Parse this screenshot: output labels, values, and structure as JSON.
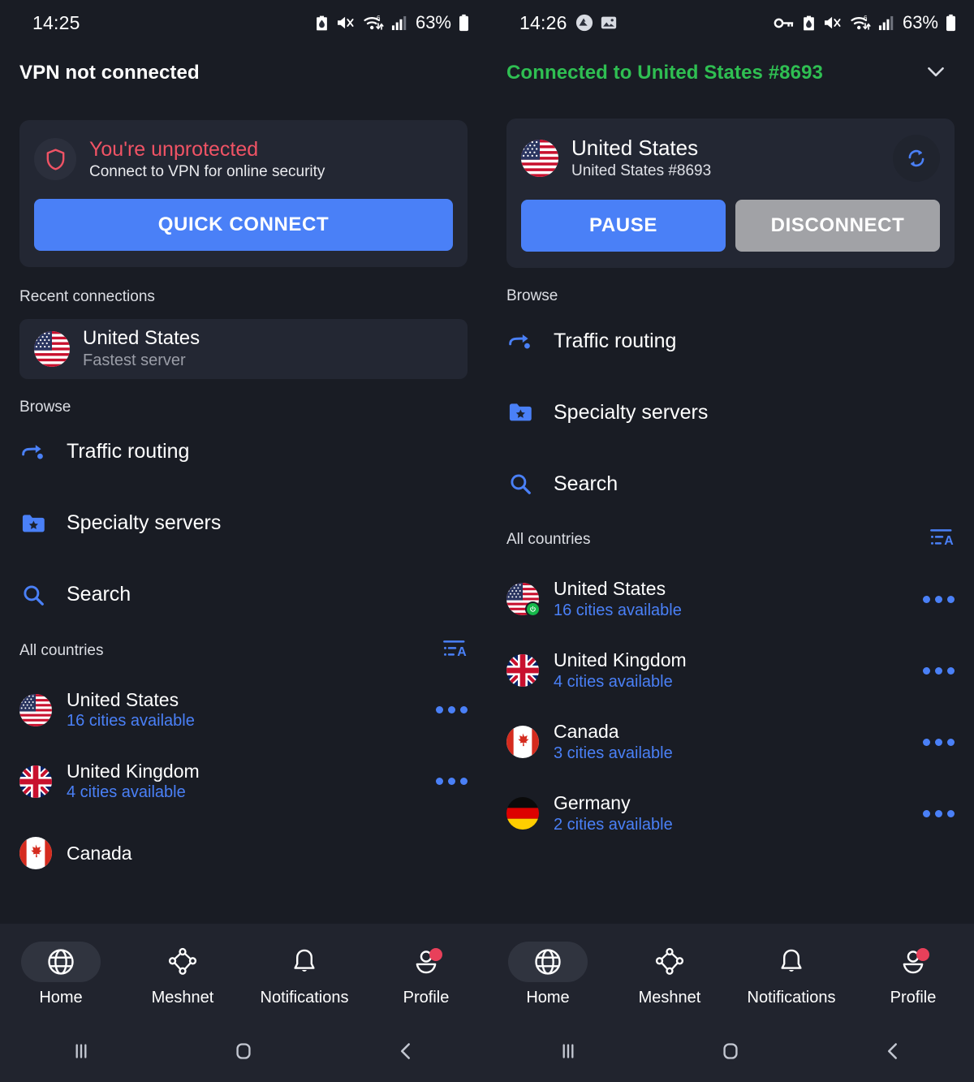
{
  "app": {
    "accent_blue": "#4a80f7",
    "danger_red": "#f05365",
    "connected_green": "#2fbf52"
  },
  "left": {
    "status_bar": {
      "time": "14:25",
      "battery_percent": "63%",
      "icons": [
        "battery-saver-icon",
        "mute-icon",
        "wifi-6-icon",
        "signal-bars-icon",
        "battery-icon"
      ]
    },
    "header": {
      "title": "VPN not connected"
    },
    "card": {
      "icon": "shield-icon",
      "title": "You're unprotected",
      "subtitle": "Connect to VPN for online security",
      "primary_button": "QUICK CONNECT"
    },
    "recent": {
      "label": "Recent connections",
      "item": {
        "flag": "us-flag-icon",
        "name": "United States",
        "subtitle": "Fastest server"
      }
    },
    "browse": {
      "label": "Browse",
      "items": [
        {
          "icon": "traffic-routing-icon",
          "label": "Traffic routing"
        },
        {
          "icon": "specialty-servers-icon",
          "label": "Specialty servers"
        },
        {
          "icon": "search-icon",
          "label": "Search"
        }
      ]
    },
    "all_countries": {
      "label": "All countries",
      "sort_icon": "sort-alpha-icon",
      "rows": [
        {
          "flag": "us-flag-icon",
          "name": "United States",
          "cities": "16 cities available",
          "connected": false
        },
        {
          "flag": "uk-flag-icon",
          "name": "United Kingdom",
          "cities": "4 cities available",
          "connected": false
        },
        {
          "flag": "ca-flag-icon",
          "name": "Canada",
          "cities": "",
          "connected": false
        }
      ]
    },
    "tabs": [
      {
        "icon": "globe-icon",
        "label": "Home",
        "active": true,
        "badge": false
      },
      {
        "icon": "meshnet-icon",
        "label": "Meshnet",
        "active": false,
        "badge": false
      },
      {
        "icon": "bell-icon",
        "label": "Notifications",
        "active": false,
        "badge": false
      },
      {
        "icon": "profile-icon",
        "label": "Profile",
        "active": false,
        "badge": true
      }
    ],
    "android_nav": [
      "recents-icon",
      "home-icon",
      "back-icon"
    ]
  },
  "right": {
    "status_bar": {
      "time": "14:26",
      "battery_percent": "63%",
      "left_icons": [
        "nord-vpn-icon",
        "screenshot-icon"
      ],
      "icons": [
        "vpn-key-icon",
        "battery-saver-icon",
        "mute-icon",
        "wifi-6-icon",
        "signal-bars-icon",
        "battery-icon"
      ]
    },
    "header": {
      "title": "Connected to United States #8693",
      "chevron": "chevron-down-icon"
    },
    "card": {
      "flag": "us-flag-icon",
      "title": "United States",
      "subtitle": "United States #8693",
      "refresh_icon": "refresh-icon",
      "primary_button": "PAUSE",
      "secondary_button": "DISCONNECT"
    },
    "browse": {
      "label": "Browse",
      "items": [
        {
          "icon": "traffic-routing-icon",
          "label": "Traffic routing"
        },
        {
          "icon": "specialty-servers-icon",
          "label": "Specialty servers"
        },
        {
          "icon": "search-icon",
          "label": "Search"
        }
      ]
    },
    "all_countries": {
      "label": "All countries",
      "sort_icon": "sort-alpha-icon",
      "rows": [
        {
          "flag": "us-flag-icon",
          "name": "United States",
          "cities": "16 cities available",
          "connected": true
        },
        {
          "flag": "uk-flag-icon",
          "name": "United Kingdom",
          "cities": "4 cities available",
          "connected": false
        },
        {
          "flag": "ca-flag-icon",
          "name": "Canada",
          "cities": "3 cities available",
          "connected": false
        },
        {
          "flag": "de-flag-icon",
          "name": "Germany",
          "cities": "2 cities available",
          "connected": false
        }
      ]
    },
    "tabs": [
      {
        "icon": "globe-icon",
        "label": "Home",
        "active": true,
        "badge": false
      },
      {
        "icon": "meshnet-icon",
        "label": "Meshnet",
        "active": false,
        "badge": false
      },
      {
        "icon": "bell-icon",
        "label": "Notifications",
        "active": false,
        "badge": false
      },
      {
        "icon": "profile-icon",
        "label": "Profile",
        "active": false,
        "badge": true
      }
    ],
    "android_nav": [
      "recents-icon",
      "home-icon",
      "back-icon"
    ]
  }
}
